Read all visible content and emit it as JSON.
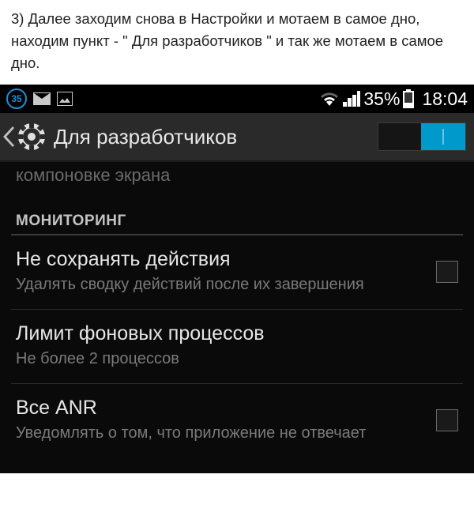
{
  "instruction": "3) Далее заходим снова в Настройки и мотаем в самое дно, находим пункт - \" Для разработчиков \" и так же мотаем в самое дно.",
  "status": {
    "notif_count": "35",
    "battery_pct": "35%",
    "time": "18:04"
  },
  "header": {
    "title": "Для разработчиков",
    "toggle_on": true
  },
  "prev_item_tail": "компоновке экрана",
  "section": "МОНИТОРИНГ",
  "items": [
    {
      "title": "Не сохранять действия",
      "sub": "Удалять сводку действий после их завершения",
      "checkbox": true
    },
    {
      "title": "Лимит фоновых процессов",
      "sub": "Не более 2 процессов",
      "checkbox": false
    },
    {
      "title": "Все ANR",
      "sub": "Уведомлять о том, что приложение не отвечает",
      "checkbox": true
    }
  ]
}
